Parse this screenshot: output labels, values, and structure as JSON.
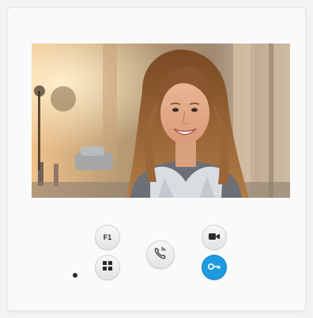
{
  "device": {
    "brand_label": "",
    "colors": {
      "housing": "#fafafa",
      "button": "#ececec",
      "door_button": "#1e9be0"
    }
  },
  "screen": {
    "content": "camera-feed-visitor"
  },
  "buttons": {
    "f1_label": "F1",
    "menu_icon": "grid-icon",
    "talk_icon": "handset-icon",
    "camera_icon": "video-camera-icon",
    "door_icon": "key-icon"
  }
}
